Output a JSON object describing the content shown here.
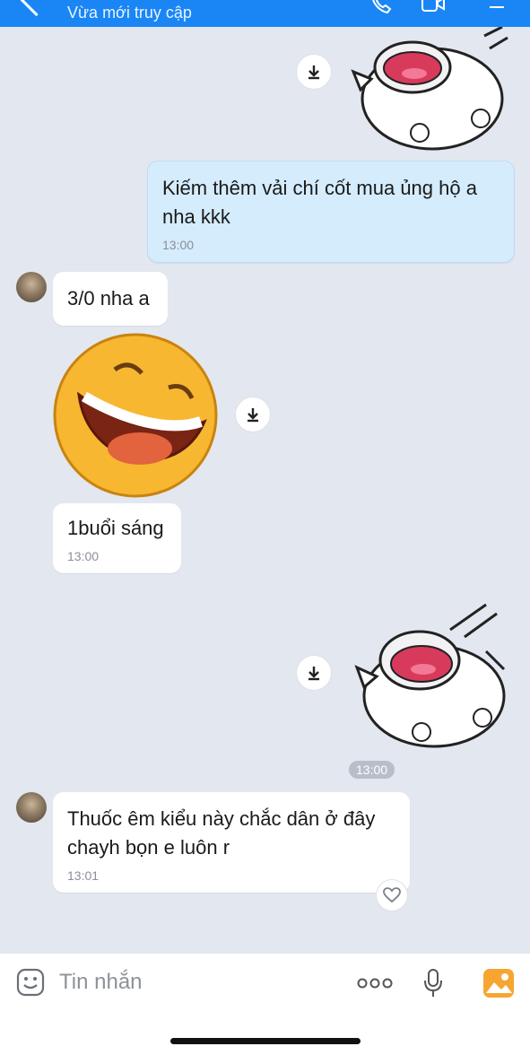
{
  "header": {
    "status": "Vừa mới truy cập"
  },
  "messages": {
    "out_text": {
      "text": "Kiếm thêm vải chí cốt mua ủng hộ a nha kkk",
      "time": "13:00"
    },
    "in_text_1": {
      "text": "3/0 nha a"
    },
    "in_text_2": {
      "text": "1buổi sáng",
      "time": "13:00"
    },
    "sticker_time_pill": "13:00",
    "in_text_3": {
      "text": "Thuốc êm kiểu này chắc dân ở đây chayh bọn e luôn r",
      "time": "13:01"
    }
  },
  "input": {
    "placeholder": "Tin nhắn"
  },
  "colors": {
    "header_bg": "#1a86f5",
    "chat_bg": "#e3e7ef",
    "outgoing_bubble": "#d5ecfc",
    "incoming_bubble": "#ffffff",
    "accent_orange": "#f7a531"
  }
}
